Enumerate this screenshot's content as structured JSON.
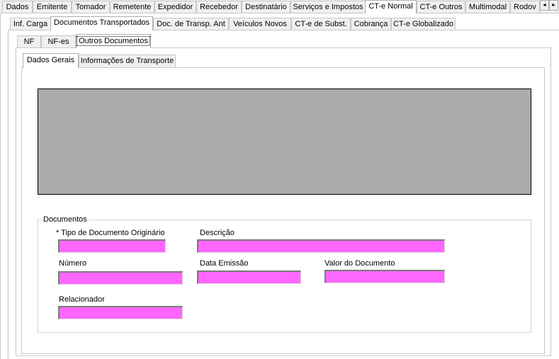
{
  "top_tabs": [
    "Dados",
    "Emitente",
    "Tomador",
    "Remetente",
    "Expedidor",
    "Recebedor",
    "Destinatário",
    "Serviços e Impostos",
    "CT-e Normal",
    "CT-e Outros",
    "Multimodal",
    "Rodov"
  ],
  "top_tabs_active": "CT-e Normal",
  "scroll_buttons": {
    "left": "◄",
    "right": "►"
  },
  "second_tabs": [
    "Inf. Carga",
    "Documentos Transportados",
    "Doc. de Transp. Ant",
    "Veículos Novos",
    "CT-e de Subst.",
    "Cobrança",
    "CT-e Globalizado"
  ],
  "second_tabs_active": "Documentos Transportados",
  "third_tabs": [
    "NF",
    "NF-es",
    "Outros Documentos"
  ],
  "third_tabs_active": "Outros Documentos",
  "fourth_tabs": [
    "Dados Gerais",
    "Informações de Transporte"
  ],
  "fourth_tabs_active": "Dados Gerais",
  "grid": {
    "background": "#ababab"
  },
  "documentos": {
    "group_title": "Documentos",
    "tipo_label": "* Tipo de Documento Originário",
    "tipo_value": "",
    "descricao_label": "Descrição",
    "descricao_value": "",
    "numero_label": "Número",
    "numero_value": "",
    "data_emissao_label": "Data Emissão",
    "data_emissao_value": "",
    "valor_label": "Valor do Documento",
    "valor_value": "",
    "relacionador_label": "Relacionador",
    "relacionador_value": ""
  },
  "colors": {
    "field_fill": "#ff66ff",
    "window_bg": "#f0f0f0"
  }
}
